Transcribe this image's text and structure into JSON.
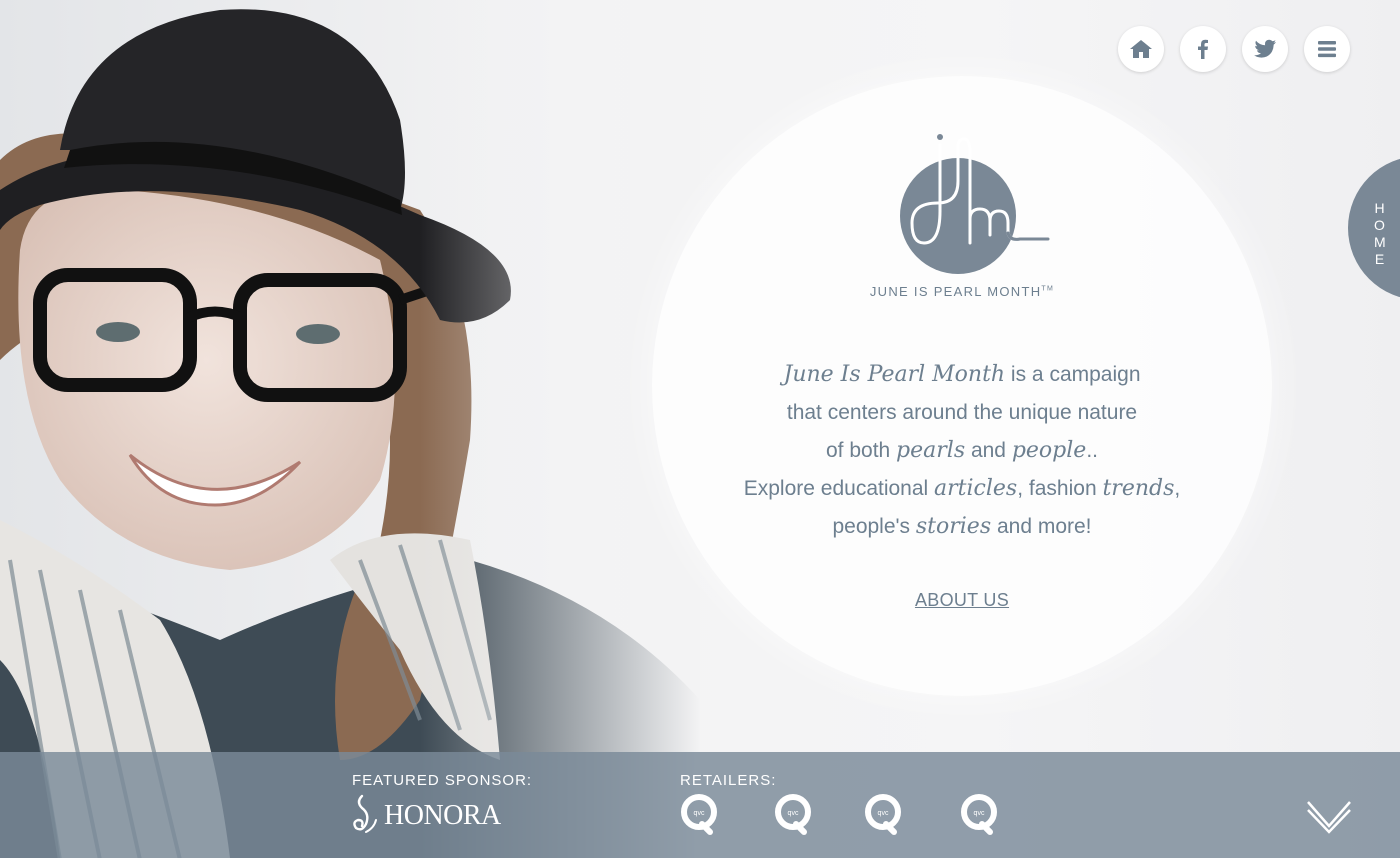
{
  "nav": {
    "icons": [
      "home-icon",
      "facebook-icon",
      "twitter-icon",
      "menu-icon"
    ]
  },
  "side_tab": {
    "label": "HOME"
  },
  "brand": {
    "name": "JUNE IS PEARL MONTH",
    "trademark": "TM",
    "color": "#6d7f8f"
  },
  "intro": {
    "line1_script": "June Is Pearl Month",
    "line1_rest": " is a campaign",
    "line2": "that centers around the  unique nature",
    "line3_a": "of both ",
    "line3_script1": "pearls",
    "line3_b": " and ",
    "line3_script2": "people",
    "line3_c": "..",
    "line4_a": "Explore educational ",
    "line4_script1": "articles",
    "line4_b": ", fashion ",
    "line4_script2": "trends",
    "line4_c": ",",
    "line5_a": "people's ",
    "line5_script": "stories",
    "line5_b": " and more!"
  },
  "cta": {
    "label": "ABOUT US"
  },
  "footer": {
    "sponsor_label": "FEATURED SPONSOR:",
    "sponsor_name": "HONORA",
    "retailers_label": "RETAILERS:",
    "retailers": [
      "qvc",
      "qvc",
      "qvc",
      "qvc"
    ],
    "scroll_icon": "chevron-down-icon",
    "background": "#7a8a98"
  }
}
